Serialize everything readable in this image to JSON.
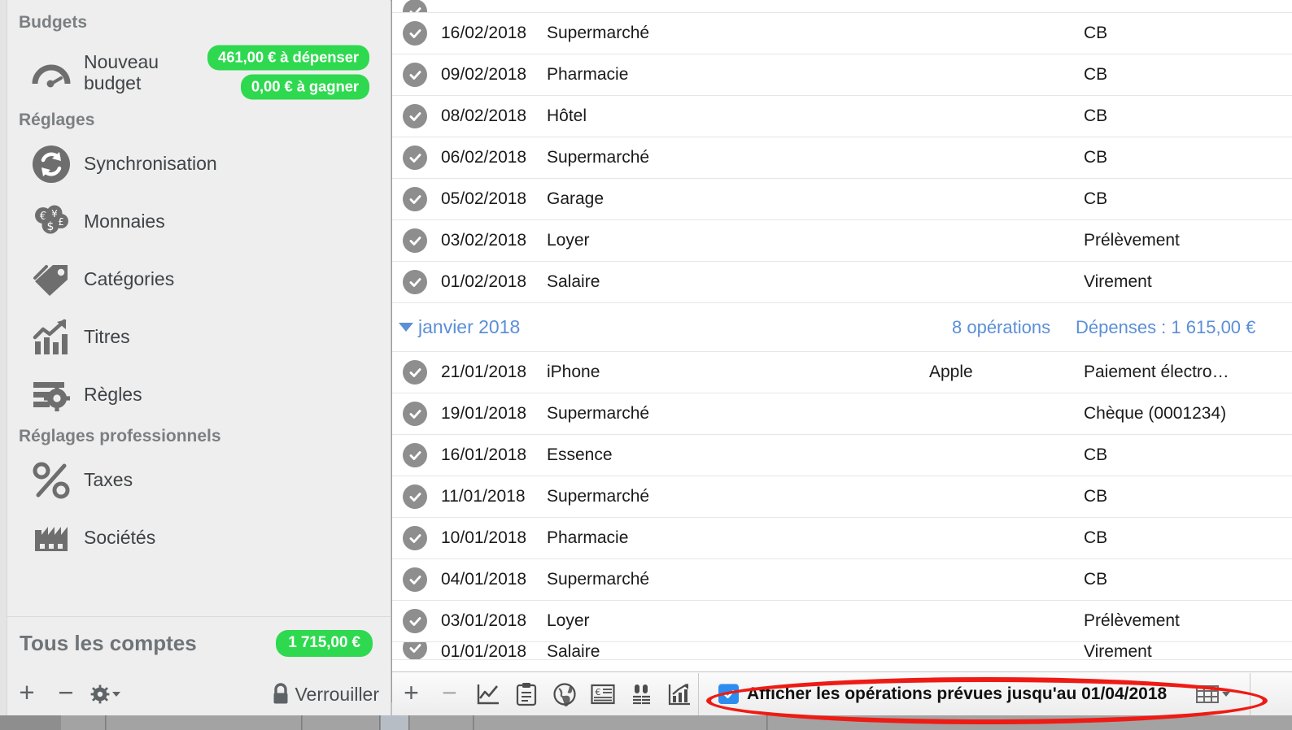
{
  "sidebar": {
    "sections": [
      {
        "title": "Budgets"
      },
      {
        "title": "Réglages"
      },
      {
        "title": "Réglages professionnels"
      }
    ],
    "budget": {
      "label_line1": "Nouveau",
      "label_line2": "budget",
      "icon": "gauge-icon",
      "badge_spend": "461,00 € à dépenser",
      "badge_earn": "0,00 € à gagner"
    },
    "settings_items": [
      {
        "label": "Synchronisation",
        "icon": "sync-icon"
      },
      {
        "label": "Monnaies",
        "icon": "coins-icon"
      },
      {
        "label": "Catégories",
        "icon": "tag-icon"
      },
      {
        "label": "Titres",
        "icon": "chart-arrow-icon"
      },
      {
        "label": "Règles",
        "icon": "rules-gear-icon"
      }
    ],
    "pro_items": [
      {
        "label": "Taxes",
        "icon": "percent-icon"
      },
      {
        "label": "Sociétés",
        "icon": "factory-icon"
      }
    ],
    "footer": {
      "accounts_label": "Tous les comptes",
      "accounts_total": "1 715,00 €",
      "add_label": "+",
      "remove_label": "−",
      "lock_label": "Verrouiller"
    },
    "colors": {
      "badge_green": "#2ed94f",
      "label_gray": "#7b7f82"
    }
  },
  "transactions": {
    "clipped_top": {
      "date": "",
      "desc": "",
      "method": ""
    },
    "feb_rows": [
      {
        "date": "16/02/2018",
        "desc": "Supermarché",
        "payee": "",
        "method": "CB"
      },
      {
        "date": "09/02/2018",
        "desc": "Pharmacie",
        "payee": "",
        "method": "CB"
      },
      {
        "date": "08/02/2018",
        "desc": "Hôtel",
        "payee": "",
        "method": "CB"
      },
      {
        "date": "06/02/2018",
        "desc": "Supermarché",
        "payee": "",
        "method": "CB"
      },
      {
        "date": "05/02/2018",
        "desc": "Garage",
        "payee": "",
        "method": "CB"
      },
      {
        "date": "03/02/2018",
        "desc": "Loyer",
        "payee": "",
        "method": "Prélèvement"
      },
      {
        "date": "01/02/2018",
        "desc": "Salaire",
        "payee": "",
        "method": "Virement"
      }
    ],
    "group_january": {
      "month": "janvier 2018",
      "count": "8 opérations",
      "total": "Dépenses : 1 615,00 €"
    },
    "jan_rows": [
      {
        "date": "21/01/2018",
        "desc": "iPhone",
        "payee": "Apple",
        "method": "Paiement électro…"
      },
      {
        "date": "19/01/2018",
        "desc": "Supermarché",
        "payee": "",
        "method": "Chèque (0001234)"
      },
      {
        "date": "16/01/2018",
        "desc": "Essence",
        "payee": "",
        "method": "CB"
      },
      {
        "date": "11/01/2018",
        "desc": "Supermarché",
        "payee": "",
        "method": "CB"
      },
      {
        "date": "10/01/2018",
        "desc": "Pharmacie",
        "payee": "",
        "method": "CB"
      },
      {
        "date": "04/01/2018",
        "desc": "Supermarché",
        "payee": "",
        "method": "CB"
      },
      {
        "date": "03/01/2018",
        "desc": "Loyer",
        "payee": "",
        "method": "Prélèvement"
      }
    ],
    "clipped_bottom": {
      "date": "01/01/2018",
      "desc": "Salaire",
      "payee": "",
      "method": "Virement"
    }
  },
  "bottom_toolbar": {
    "add_label": "+",
    "remove_label": "−",
    "icons": [
      "line-chart-icon",
      "clipboard-icon",
      "globe-icon",
      "euro-invoice-icon",
      "sliders-icon",
      "bar-chart-icon"
    ],
    "checkbox_label": "Afficher les opérations prévues jusqu'au 01/04/2018",
    "checkbox_checked": "true",
    "grid_icon": "grid-view-icon",
    "highlight_color": "#ee1b14"
  }
}
